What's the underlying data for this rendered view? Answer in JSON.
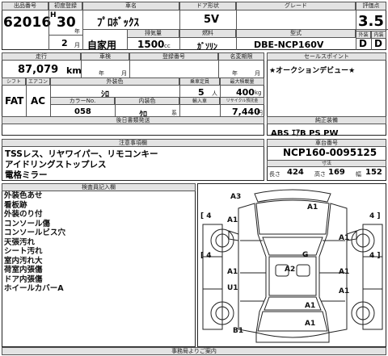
{
  "header": {
    "lot_label": "出品番号",
    "lot": "62016",
    "year_label": "初度登録",
    "year_era": "H",
    "year": "30",
    "year_unit": "年",
    "month": "2",
    "month_unit": "月",
    "maker_label": "車名",
    "maker": "ﾌﾟﾛﾎﾞｯｸｽ",
    "usage": "自家用",
    "doors_label": "ドア形状",
    "doors": "5V",
    "grade_label": "グレード",
    "displacement_label": "排気量",
    "displacement": "1500",
    "displacement_unit": "cc",
    "fuel_label": "燃料",
    "fuel": "ｶﾞｿﾘﾝ",
    "model_label": "型式",
    "model": "DBE-NCP160V",
    "eval_label": "評価点",
    "score": "3.5",
    "exterior_label": "外装",
    "interior_label": "内装",
    "exterior": "D",
    "interior": "D"
  },
  "row2": {
    "mileage_label": "走行",
    "mileage": "87,079",
    "mileage_unit": "km",
    "inspection_label": "車検",
    "insp_year_unit": "年",
    "insp_month_unit": "月",
    "reg_label": "登録番号",
    "owner_label": "名変期限",
    "owner_year_unit": "年",
    "owner_month_unit": "月",
    "shift_label": "シフト",
    "ac_label": "エアコン",
    "shift": "FAT",
    "ac": "AC",
    "color_label": "外装色",
    "color": "ｼﾛ",
    "colorno_label": "カラーNo.",
    "colorno": "058",
    "intcolor_label": "内装色",
    "intcolor": "ｸﾛ",
    "intcolor_unit": "系",
    "capacity_label": "乗車定員",
    "capacity": "5",
    "capacity_unit": "人",
    "load_label": "最大積載量",
    "load": "400",
    "load_unit": "kg",
    "import_label": "輸入車",
    "recycle_label": "リサイクル預託金",
    "recycle": "7,440",
    "recycle_unit": "円",
    "equip_label": "後日書類発送"
  },
  "sales_point": {
    "label": "セールスポイント",
    "text": "★オークションデビュー★"
  },
  "options": {
    "label": "純正装備",
    "text": "ABS ｴｱB PS PW"
  },
  "notes": {
    "label": "注意事項欄",
    "lines": [
      "TSSレス、リヤワイパー、リモコンキー",
      "アイドリングストップレス",
      "電格ミラー"
    ]
  },
  "chassis": {
    "label": "車台番号",
    "number": "NCP160-0095125",
    "size_label": "寸法",
    "length_label": "長さ",
    "length": "424",
    "height_label": "高さ",
    "height": "169",
    "width_label": "幅",
    "width": "152"
  },
  "inspector": {
    "label": "検査員記入欄",
    "lines": [
      "外装色あせ",
      "看板跡",
      "外装のり付",
      "コンソール傷",
      "コンソールビス穴",
      "天張汚れ",
      "シート汚れ",
      "室内汚れ大",
      "荷室内張傷",
      "ドア内張傷",
      "ホイールカバーA"
    ]
  },
  "diagram": {
    "marks": {
      "front_bumper": "A3",
      "hood": "A1",
      "front_left": "A1",
      "front_right": "A1",
      "center": "G",
      "roof": "A2",
      "left_door": "A1",
      "right_door": "A1",
      "rear_left": "U1",
      "right_rear": "A1",
      "rear_bumper": "A1",
      "back_door": "A1",
      "rear_bottom_left": "B1",
      "wheel_fl": "4",
      "wheel_fr": "4",
      "wheel_rl": "4",
      "wheel_rr": "4"
    }
  },
  "footer": {
    "label": "事務局よりご案内"
  }
}
